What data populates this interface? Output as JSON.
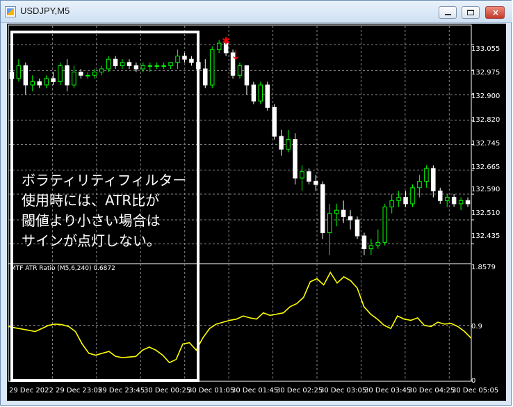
{
  "window": {
    "title": "USDJPY,M5",
    "buttons": [
      "minimize-button",
      "maximize-button",
      "close-button"
    ]
  },
  "price_axis": {
    "labels": [
      "133.055",
      "132.975",
      "132.900",
      "132.820",
      "132.745",
      "132.665",
      "132.590",
      "132.510",
      "132.435"
    ]
  },
  "indicator": {
    "label": "MTF ATR Ratio  (M5,6,240) 0.6872",
    "axis_labels": [
      "1.8579",
      "0.9",
      "0"
    ]
  },
  "time_axis": {
    "labels": [
      "29 Dec 2022",
      "29 Dec 23:05",
      "29 Dec 23:45",
      "30 Dec 00:25",
      "30 Dec 01:05",
      "30 Dec 01:45",
      "30 Dec 02:25",
      "30 Dec 03:05",
      "30 Dec 03:45",
      "30 Dec 04:25",
      "30 Dec 05:05"
    ]
  },
  "annotation": {
    "lines": [
      "ボラティリティフィルター",
      "使用時には、ATR比が",
      "閾値より小さい場合は",
      "サインが点灯しない。"
    ]
  },
  "colors": {
    "up_candle": "#00ff00",
    "down_candle": "#ffffff",
    "indicator_line": "#ffff00",
    "signal_marker": "#ff0000",
    "grid": "#8a8a8a",
    "background": "#000000"
  },
  "chart_data": {
    "type": "candlestick",
    "symbol": "USDJPY",
    "timeframe": "M5",
    "price_ylim": [
      132.38,
      133.11
    ],
    "indicator_ylim": [
      0,
      1.8579
    ],
    "candles": [
      {
        "o": 132.97,
        "h": 132.99,
        "l": 132.93,
        "c": 132.95
      },
      {
        "o": 132.95,
        "h": 133.01,
        "l": 132.94,
        "c": 132.99
      },
      {
        "o": 132.99,
        "h": 133.0,
        "l": 132.9,
        "c": 132.93
      },
      {
        "o": 132.93,
        "h": 132.96,
        "l": 132.91,
        "c": 132.94
      },
      {
        "o": 132.94,
        "h": 132.95,
        "l": 132.92,
        "c": 132.93
      },
      {
        "o": 132.93,
        "h": 132.96,
        "l": 132.92,
        "c": 132.95
      },
      {
        "o": 132.95,
        "h": 132.97,
        "l": 132.93,
        "c": 132.94
      },
      {
        "o": 132.94,
        "h": 133.0,
        "l": 132.93,
        "c": 132.99
      },
      {
        "o": 132.99,
        "h": 133.01,
        "l": 132.91,
        "c": 132.93
      },
      {
        "o": 132.93,
        "h": 132.99,
        "l": 132.92,
        "c": 132.97
      },
      {
        "o": 132.97,
        "h": 132.98,
        "l": 132.95,
        "c": 132.96
      },
      {
        "o": 132.96,
        "h": 132.97,
        "l": 132.95,
        "c": 132.96
      },
      {
        "o": 132.96,
        "h": 132.98,
        "l": 132.95,
        "c": 132.97
      },
      {
        "o": 132.97,
        "h": 132.99,
        "l": 132.96,
        "c": 132.98
      },
      {
        "o": 132.98,
        "h": 133.02,
        "l": 132.97,
        "c": 133.01
      },
      {
        "o": 133.01,
        "h": 133.02,
        "l": 132.98,
        "c": 132.99
      },
      {
        "o": 132.99,
        "h": 133.01,
        "l": 132.98,
        "c": 133.0
      },
      {
        "o": 133.0,
        "h": 133.01,
        "l": 132.98,
        "c": 132.99
      },
      {
        "o": 132.99,
        "h": 133.0,
        "l": 132.97,
        "c": 132.98
      },
      {
        "o": 132.98,
        "h": 133.0,
        "l": 132.97,
        "c": 132.99
      },
      {
        "o": 132.99,
        "h": 133.0,
        "l": 132.97,
        "c": 132.99
      },
      {
        "o": 132.99,
        "h": 133.0,
        "l": 132.98,
        "c": 132.99
      },
      {
        "o": 132.99,
        "h": 133.0,
        "l": 132.98,
        "c": 132.99
      },
      {
        "o": 132.99,
        "h": 133.0,
        "l": 132.98,
        "c": 133.0
      },
      {
        "o": 133.0,
        "h": 133.04,
        "l": 132.98,
        "c": 133.02
      },
      {
        "o": 133.02,
        "h": 133.03,
        "l": 133.0,
        "c": 133.01
      },
      {
        "o": 133.01,
        "h": 133.02,
        "l": 132.99,
        "c": 133.0
      },
      {
        "o": 133.0,
        "h": 133.01,
        "l": 132.97,
        "c": 132.98
      },
      {
        "o": 132.98,
        "h": 133.01,
        "l": 132.92,
        "c": 132.93
      },
      {
        "o": 132.93,
        "h": 133.05,
        "l": 132.92,
        "c": 133.04
      },
      {
        "o": 133.04,
        "h": 133.07,
        "l": 133.03,
        "c": 133.06
      },
      {
        "o": 133.06,
        "h": 133.07,
        "l": 133.02,
        "c": 133.03
      },
      {
        "o": 133.03,
        "h": 133.04,
        "l": 132.95,
        "c": 132.96
      },
      {
        "o": 132.96,
        "h": 133.0,
        "l": 132.95,
        "c": 132.99
      },
      {
        "o": 132.99,
        "h": 132.99,
        "l": 132.9,
        "c": 132.93
      },
      {
        "o": 132.93,
        "h": 132.94,
        "l": 132.87,
        "c": 132.88
      },
      {
        "o": 132.88,
        "h": 132.94,
        "l": 132.87,
        "c": 132.93
      },
      {
        "o": 132.93,
        "h": 132.94,
        "l": 132.85,
        "c": 132.86
      },
      {
        "o": 132.86,
        "h": 132.87,
        "l": 132.76,
        "c": 132.77
      },
      {
        "o": 132.77,
        "h": 132.79,
        "l": 132.71,
        "c": 132.73
      },
      {
        "o": 132.73,
        "h": 132.79,
        "l": 132.72,
        "c": 132.76
      },
      {
        "o": 132.76,
        "h": 132.78,
        "l": 132.62,
        "c": 132.64
      },
      {
        "o": 132.64,
        "h": 132.68,
        "l": 132.6,
        "c": 132.66
      },
      {
        "o": 132.66,
        "h": 132.67,
        "l": 132.62,
        "c": 132.63
      },
      {
        "o": 132.63,
        "h": 132.65,
        "l": 132.6,
        "c": 132.62
      },
      {
        "o": 132.62,
        "h": 132.63,
        "l": 132.45,
        "c": 132.47
      },
      {
        "o": 132.47,
        "h": 132.56,
        "l": 132.4,
        "c": 132.53
      },
      {
        "o": 132.53,
        "h": 132.56,
        "l": 132.49,
        "c": 132.54
      },
      {
        "o": 132.54,
        "h": 132.57,
        "l": 132.5,
        "c": 132.52
      },
      {
        "o": 132.52,
        "h": 132.54,
        "l": 132.48,
        "c": 132.51
      },
      {
        "o": 132.51,
        "h": 132.52,
        "l": 132.45,
        "c": 132.46
      },
      {
        "o": 132.46,
        "h": 132.47,
        "l": 132.4,
        "c": 132.42
      },
      {
        "o": 132.42,
        "h": 132.45,
        "l": 132.4,
        "c": 132.43
      },
      {
        "o": 132.43,
        "h": 132.48,
        "l": 132.42,
        "c": 132.44
      },
      {
        "o": 132.44,
        "h": 132.56,
        "l": 132.43,
        "c": 132.55
      },
      {
        "o": 132.55,
        "h": 132.59,
        "l": 132.53,
        "c": 132.57
      },
      {
        "o": 132.57,
        "h": 132.6,
        "l": 132.55,
        "c": 132.58
      },
      {
        "o": 132.58,
        "h": 132.6,
        "l": 132.55,
        "c": 132.56
      },
      {
        "o": 132.56,
        "h": 132.62,
        "l": 132.55,
        "c": 132.61
      },
      {
        "o": 132.61,
        "h": 132.65,
        "l": 132.58,
        "c": 132.63
      },
      {
        "o": 132.63,
        "h": 132.68,
        "l": 132.61,
        "c": 132.67
      },
      {
        "o": 132.67,
        "h": 132.68,
        "l": 132.58,
        "c": 132.6
      },
      {
        "o": 132.6,
        "h": 132.61,
        "l": 132.56,
        "c": 132.57
      },
      {
        "o": 132.57,
        "h": 132.59,
        "l": 132.55,
        "c": 132.58
      },
      {
        "o": 132.58,
        "h": 132.59,
        "l": 132.55,
        "c": 132.56
      },
      {
        "o": 132.56,
        "h": 132.58,
        "l": 132.54,
        "c": 132.57
      },
      {
        "o": 132.57,
        "h": 132.58,
        "l": 132.55,
        "c": 132.56
      }
    ],
    "indicator_values": [
      0.88,
      0.86,
      0.84,
      0.82,
      0.8,
      0.85,
      0.9,
      0.92,
      0.91,
      0.88,
      0.8,
      0.6,
      0.45,
      0.42,
      0.45,
      0.48,
      0.4,
      0.38,
      0.39,
      0.4,
      0.5,
      0.55,
      0.5,
      0.42,
      0.3,
      0.35,
      0.6,
      0.62,
      0.5,
      0.7,
      0.85,
      0.92,
      0.95,
      0.98,
      1.0,
      1.05,
      1.02,
      1.0,
      1.1,
      1.06,
      1.08,
      1.1,
      1.2,
      1.25,
      1.35,
      1.6,
      1.65,
      1.55,
      1.75,
      1.58,
      1.68,
      1.62,
      1.5,
      1.2,
      1.08,
      1.0,
      0.9,
      0.85,
      1.05,
      1.0,
      0.98,
      1.02,
      0.9,
      0.88,
      0.95,
      0.92,
      0.93,
      0.88,
      0.8,
      0.69
    ],
    "signals": [
      {
        "index": 31,
        "marker": "star"
      },
      {
        "index": 32,
        "marker": "down-arrow"
      }
    ]
  }
}
